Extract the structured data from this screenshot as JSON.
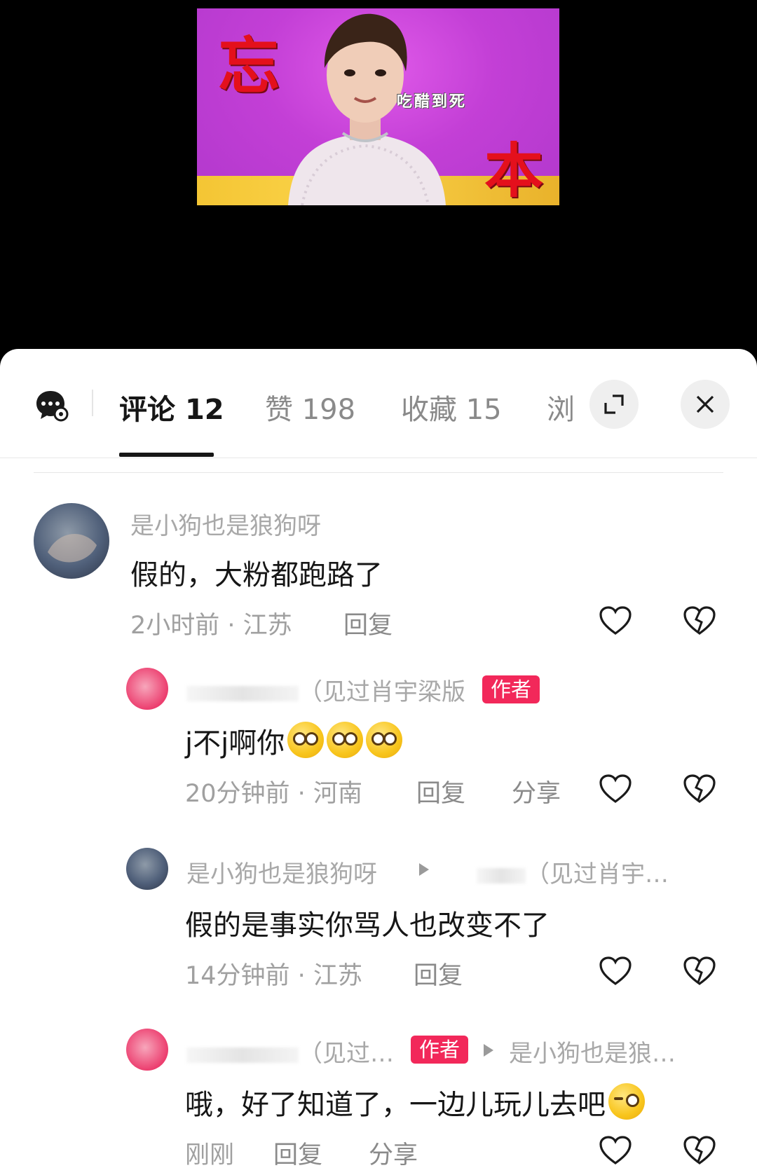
{
  "tabs": [
    {
      "label": "评论",
      "count": "12",
      "active": true
    },
    {
      "label": "赞",
      "count": "198",
      "active": false
    },
    {
      "label": "收藏",
      "count": "15",
      "active": false
    },
    {
      "label": "浏",
      "count": "",
      "active": false
    }
  ],
  "video": {
    "char_left": "忘",
    "char_right": "本",
    "caption": "吃醋到死"
  },
  "comments": [
    {
      "username": "是小狗也是狼狗呀",
      "text": "假的，大粉都跑路了",
      "time": "2小时前",
      "location": "江苏",
      "reply_label": "回复",
      "share_label": ""
    },
    {
      "username": "（见过肖宇梁版",
      "badge": "作者",
      "text": "j不j啊你",
      "time": "20分钟前",
      "location": "河南",
      "reply_label": "回复",
      "share_label": "分享"
    },
    {
      "username": "是小狗也是狼狗呀",
      "reply_to": "（见过肖宇…",
      "text": "假的是事实你骂人也改变不了",
      "time": "14分钟前",
      "location": "江苏",
      "reply_label": "回复",
      "share_label": ""
    },
    {
      "username": "（见过…",
      "badge": "作者",
      "reply_to": "是小狗也是狼…",
      "text": "哦，好了知道了，一边儿玩儿去吧",
      "time": "刚刚",
      "location": "",
      "reply_label": "回复",
      "share_label": "分享"
    }
  ],
  "colors": {
    "badge": "#f2285a",
    "text_primary": "#161616",
    "text_secondary": "#a0a0a0",
    "video_bg": "#c33fd6"
  },
  "icons": [
    "chat-settings-icon",
    "expand-icon",
    "close-icon",
    "heart-icon",
    "broken-heart-icon",
    "dizzy-emoji-icon",
    "wink-tongue-emoji-icon"
  ]
}
